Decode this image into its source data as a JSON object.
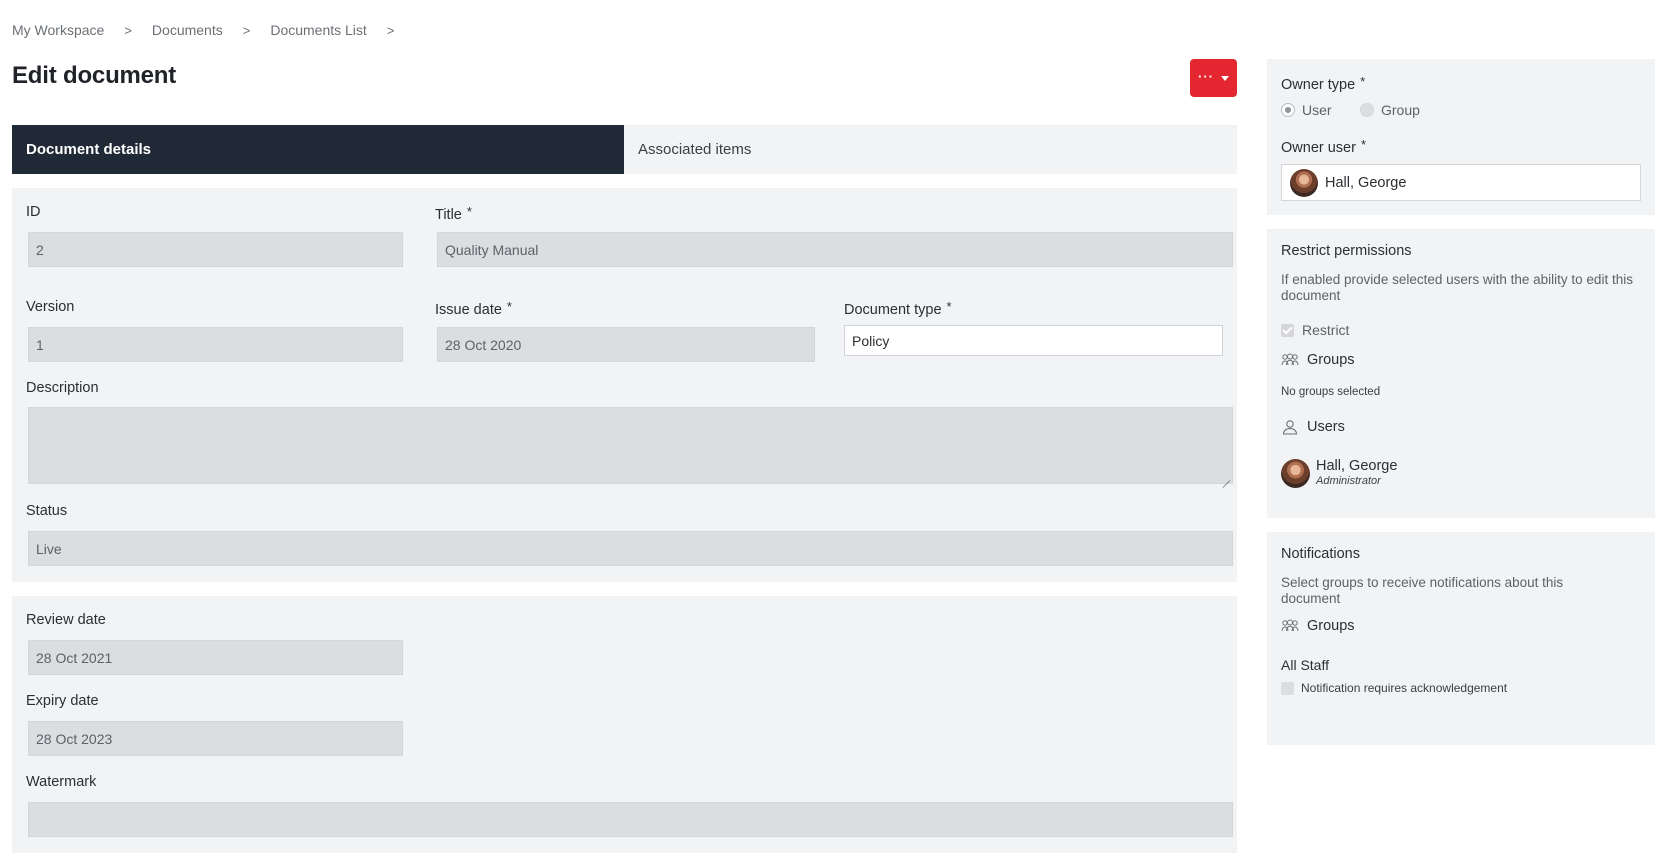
{
  "breadcrumb": {
    "items": [
      "My Workspace",
      "Documents",
      "Documents List"
    ],
    "separator": ">"
  },
  "page": {
    "title": "Edit document",
    "more_button_label": "···"
  },
  "tabs": [
    {
      "label": "Document details",
      "active": true
    },
    {
      "label": "Associated items",
      "active": false
    }
  ],
  "form": {
    "id": {
      "label": "ID",
      "value": "2"
    },
    "title": {
      "label": "Title",
      "required": "*",
      "value": "Quality Manual"
    },
    "version": {
      "label": "Version",
      "value": "1"
    },
    "issue_date": {
      "label": "Issue date",
      "required": "*",
      "value": "28 Oct 2020"
    },
    "document_type": {
      "label": "Document type",
      "required": "*",
      "value": "Policy"
    },
    "description": {
      "label": "Description",
      "value": ""
    },
    "status": {
      "label": "Status",
      "value": "Live"
    },
    "review_date": {
      "label": "Review date",
      "value": "28 Oct 2021"
    },
    "expiry_date": {
      "label": "Expiry date",
      "value": "28 Oct 2023"
    },
    "watermark": {
      "label": "Watermark",
      "value": ""
    }
  },
  "owner": {
    "owner_type_label": "Owner type",
    "required": "*",
    "options": [
      {
        "label": "User",
        "selected": true
      },
      {
        "label": "Group",
        "selected": false
      }
    ],
    "owner_user_label": "Owner user",
    "owner_user_value": "Hall, George"
  },
  "permissions": {
    "title": "Restrict permissions",
    "description": "If enabled provide selected users with the ability to edit this document",
    "restrict_label": "Restrict",
    "restrict_checked": true,
    "groups_label": "Groups",
    "groups_empty": "No groups selected",
    "users_label": "Users",
    "users": [
      {
        "name": "Hall, George",
        "role": "Administrator"
      }
    ]
  },
  "notifications": {
    "title": "Notifications",
    "description": "Select groups to receive notifications about this document",
    "groups_label": "Groups",
    "group_name": "All Staff",
    "ack_label": "Notification requires acknowledgement",
    "ack_checked": false
  },
  "colors": {
    "accent_red": "#e3262f",
    "tab_active_bg": "#1f2a36",
    "panel_bg": "#f2f3f4",
    "field_bg": "#dcdde0"
  },
  "icons": {
    "more": "ellipsis-icon",
    "dropdown": "caret-down-icon",
    "groups": "groups-icon",
    "users": "user-icon",
    "resize": "resize-handle-icon"
  }
}
